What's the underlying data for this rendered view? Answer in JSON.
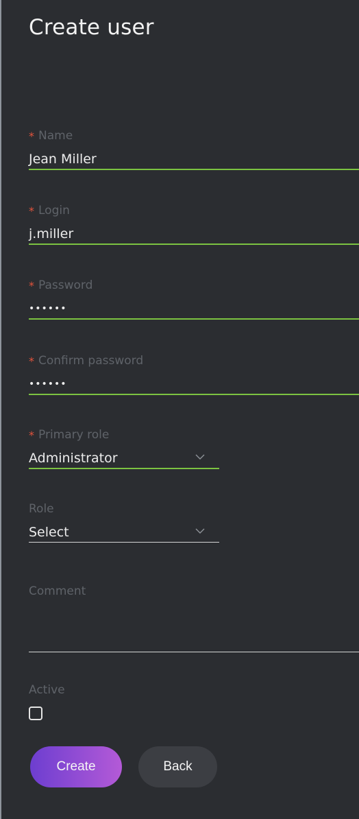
{
  "page": {
    "title": "Create user"
  },
  "form": {
    "name": {
      "label": "Name",
      "required_mark": "*",
      "value": "Jean Miller"
    },
    "login": {
      "label": "Login",
      "required_mark": "*",
      "value": "j.miller"
    },
    "password": {
      "label": "Password",
      "required_mark": "*",
      "value": "••••••"
    },
    "confirm_password": {
      "label": "Confirm password",
      "required_mark": "*",
      "value": "••••••"
    },
    "primary_role": {
      "label": "Primary role",
      "required_mark": "*",
      "value": "Administrator",
      "icon": "chevron-down-icon"
    },
    "role": {
      "label": "Role",
      "value": "Select",
      "icon": "chevron-down-icon"
    },
    "comment": {
      "label": "Comment",
      "value": ""
    },
    "active": {
      "label": "Active",
      "checked": false
    }
  },
  "buttons": {
    "create_label": "Create",
    "back_label": "Back"
  },
  "colors": {
    "background": "#2b2d31",
    "accent_green": "#7cc341",
    "required_red": "#e2533c",
    "create_gradient_start": "#6d3ed0",
    "create_gradient_end": "#b45ad7",
    "back_button": "#3c3e43"
  }
}
